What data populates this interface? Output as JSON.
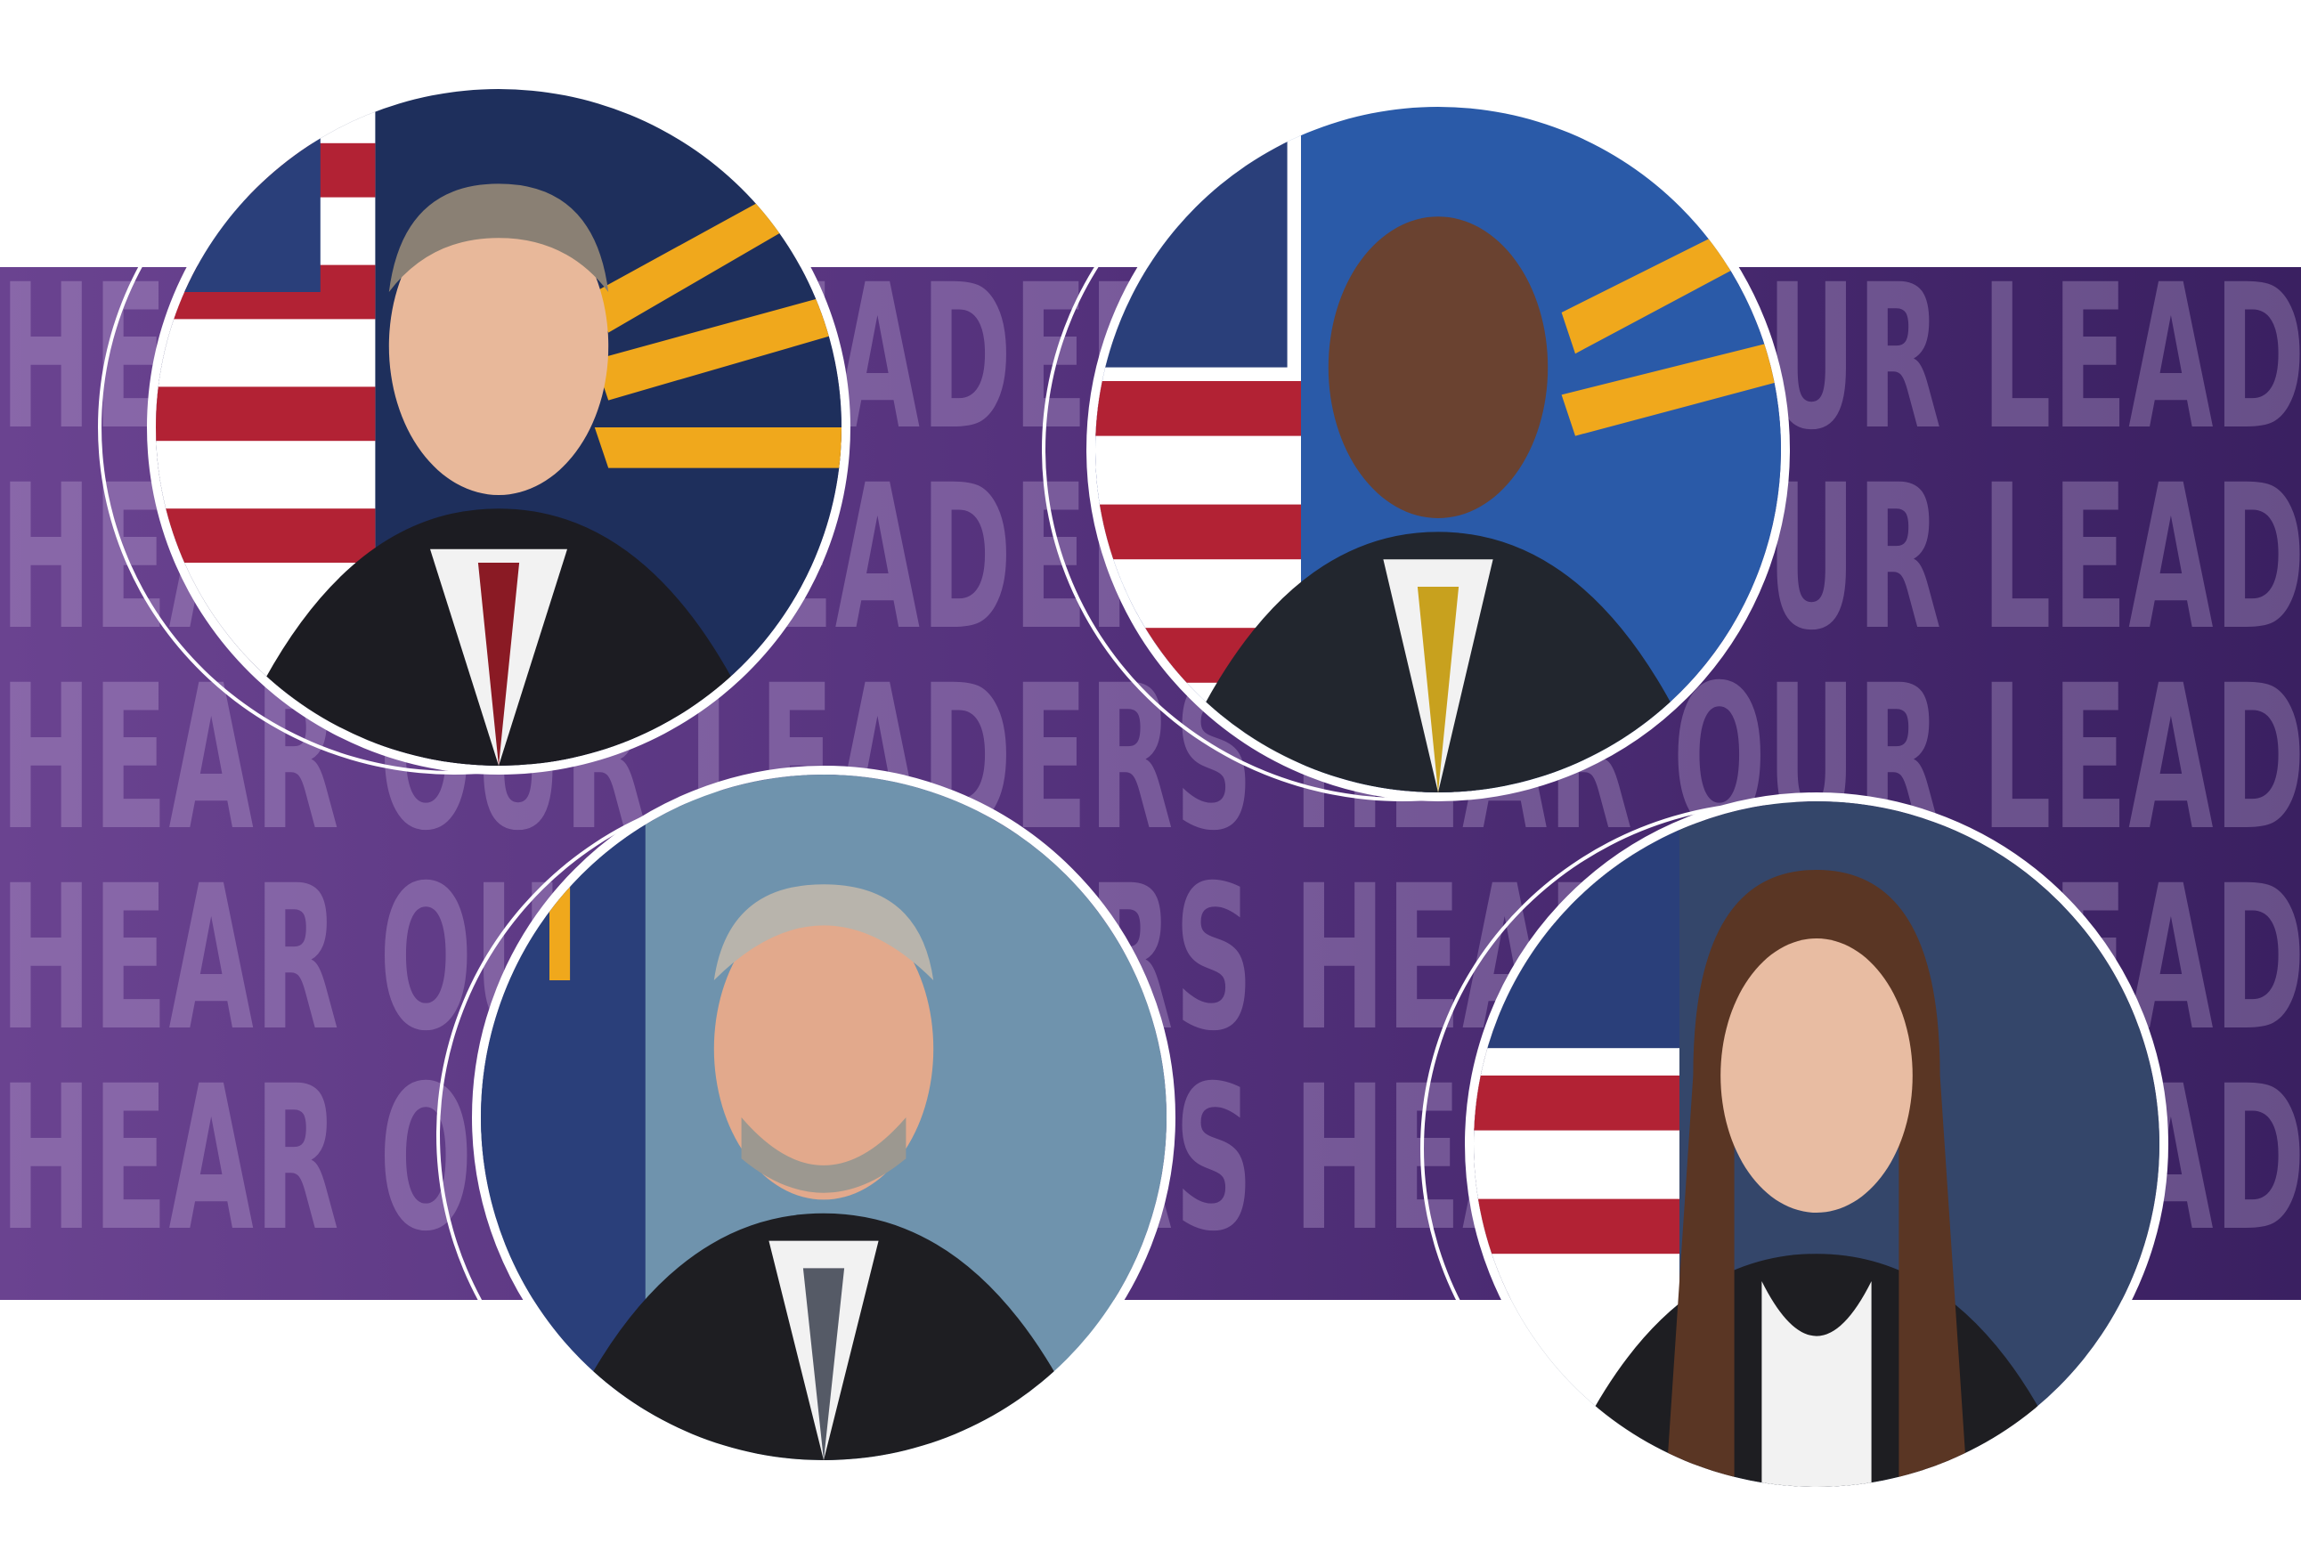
{
  "banner": {
    "rows": [
      "HEAR OUR LEADERS HEAR OUR LEADERS",
      "HEAR OUR LEADERS HEAR OUR LEADERS",
      "HEAR OUR LEADERS HEAR OUR LEADERS",
      "HEAR OUR LEADERS HEAR OUR LEADERS",
      "HEAR OUR LEADERS HEAR OUR LEADERS"
    ]
  },
  "colors": {
    "band_left": "#6a4390",
    "band_right": "#3a2061",
    "text_overlay": "#d2bee6",
    "flag_red": "#b22234",
    "flag_blue": "#2a3f7a",
    "seal_gold": "#f0a81c"
  }
}
